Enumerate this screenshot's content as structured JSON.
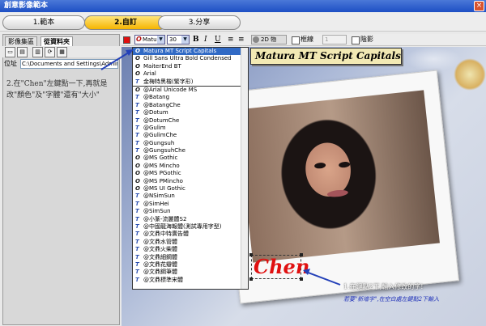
{
  "window": {
    "title": "創意影像範本",
    "close_symbol": "×"
  },
  "steps": [
    {
      "label": "1.範本",
      "active": false
    },
    {
      "label": "2.自訂",
      "active": true
    },
    {
      "label": "3.分享",
      "active": false
    }
  ],
  "left_panel": {
    "tabs": [
      {
        "label": "影像集區",
        "active": false
      },
      {
        "label": "從資料夾",
        "active": true
      }
    ],
    "toolbar_icons": [
      "folder-icon",
      "import-icon",
      "split-icon",
      "refresh-icon",
      "view-icon"
    ],
    "address_label": "位址",
    "address_value": "C:\\Documents and Settings\\Administrator",
    "instruction": "2.在\"Chen\"左鍵點一下,再就是改\"顏色\"及\"字體\"還有\"大小\""
  },
  "format_toolbar": {
    "font_icon": "O",
    "font_value": "Matura",
    "size_value": "30",
    "bold": "B",
    "italic": "I",
    "underline": "U",
    "effect_value": "2D 物",
    "checkbox_border": "框線",
    "spin_value": "1",
    "checkbox_shadow": "陰影"
  },
  "font_preview": "Matura MT Script Capitals",
  "font_list": [
    {
      "name": "Matura MT Script Capitals",
      "type": "o",
      "selected": true,
      "sep": false
    },
    {
      "name": "Gill Sans Ultra Bold Condensed",
      "type": "o",
      "selected": false,
      "sep": false
    },
    {
      "name": "MaiterEnd BT",
      "type": "o",
      "selected": false,
      "sep": false
    },
    {
      "name": "Arial",
      "type": "o",
      "selected": false,
      "sep": false
    },
    {
      "name": "金梅特黑楷(繁字形)",
      "type": "t",
      "selected": false,
      "sep": true
    },
    {
      "name": "@Arial Unicode MS",
      "type": "o",
      "selected": false,
      "sep": false
    },
    {
      "name": "@Batang",
      "type": "t",
      "selected": false,
      "sep": false
    },
    {
      "name": "@BatangChe",
      "type": "t",
      "selected": false,
      "sep": false
    },
    {
      "name": "@Dotum",
      "type": "t",
      "selected": false,
      "sep": false
    },
    {
      "name": "@DotumChe",
      "type": "t",
      "selected": false,
      "sep": false
    },
    {
      "name": "@Gulim",
      "type": "t",
      "selected": false,
      "sep": false
    },
    {
      "name": "@GulimChe",
      "type": "t",
      "selected": false,
      "sep": false
    },
    {
      "name": "@Gungsuh",
      "type": "t",
      "selected": false,
      "sep": false
    },
    {
      "name": "@GungsuhChe",
      "type": "t",
      "selected": false,
      "sep": false
    },
    {
      "name": "@MS Gothic",
      "type": "o",
      "selected": false,
      "sep": false
    },
    {
      "name": "@MS Mincho",
      "type": "o",
      "selected": false,
      "sep": false
    },
    {
      "name": "@MS PGothic",
      "type": "o",
      "selected": false,
      "sep": false
    },
    {
      "name": "@MS PMincho",
      "type": "o",
      "selected": false,
      "sep": false
    },
    {
      "name": "@MS UI Gothic",
      "type": "o",
      "selected": false,
      "sep": false
    },
    {
      "name": "@NSimSun",
      "type": "t",
      "selected": false,
      "sep": false
    },
    {
      "name": "@SimHei",
      "type": "t",
      "selected": false,
      "sep": false
    },
    {
      "name": "@SimSun",
      "type": "t",
      "selected": false,
      "sep": false
    },
    {
      "name": "@小篆-流麗體S2",
      "type": "t",
      "selected": false,
      "sep": false
    },
    {
      "name": "@中國龍海報體(測試專用字型)",
      "type": "t",
      "selected": false,
      "sep": false
    },
    {
      "name": "@文鼎中特廣告體",
      "type": "t",
      "selected": false,
      "sep": false
    },
    {
      "name": "@文鼎水管體",
      "type": "t",
      "selected": false,
      "sep": false
    },
    {
      "name": "@文鼎火柴體",
      "type": "t",
      "selected": false,
      "sep": false
    },
    {
      "name": "@文鼎細鋼體",
      "type": "t",
      "selected": false,
      "sep": false
    },
    {
      "name": "@文鼎花瓣體",
      "type": "t",
      "selected": false,
      "sep": false
    },
    {
      "name": "@文鼎鋼筆體",
      "type": "t",
      "selected": false,
      "sep": false
    },
    {
      "name": "@文鼎標準宋體",
      "type": "t",
      "selected": false,
      "sep": false
    }
  ],
  "canvas_text": "Chen",
  "annotation_1": "1.在鍵點2下,輸入修改的字!",
  "annotation_1_note": "若要\"新增字\",在空白處左鍵點2下輸入",
  "colors": {
    "text_color": "#e01010",
    "accent": "#316ac5",
    "arrow": "#2340b8"
  }
}
